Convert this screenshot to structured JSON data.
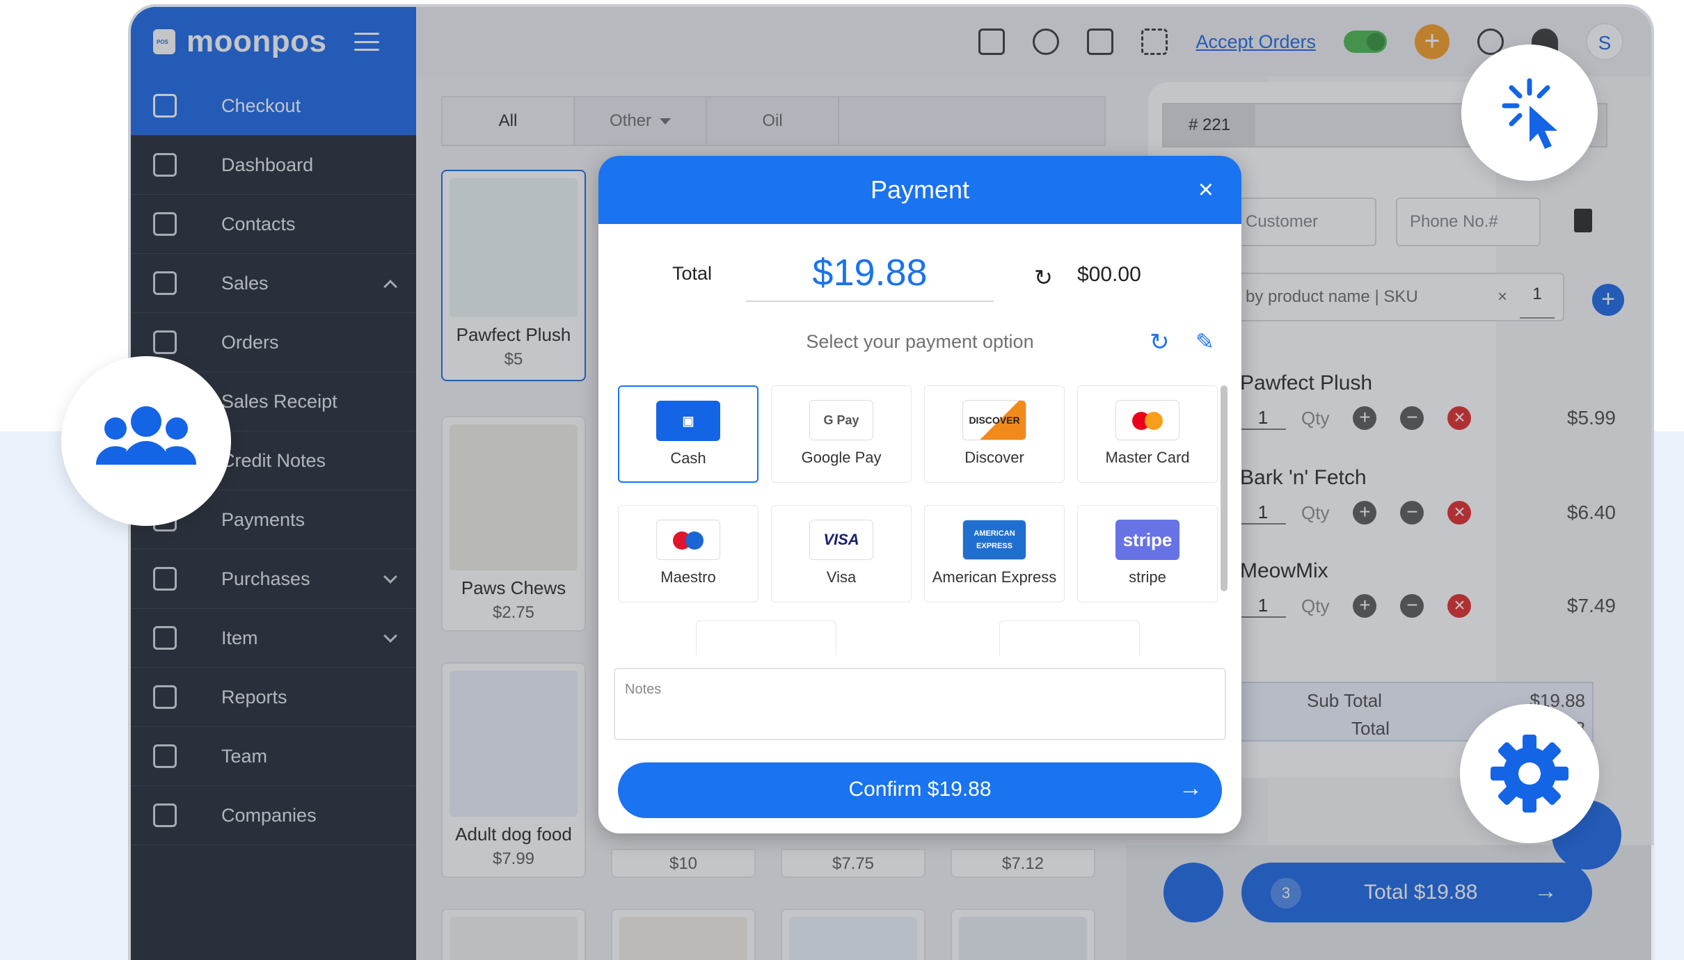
{
  "brand": {
    "name": "moonpos"
  },
  "sidebar": {
    "items": [
      {
        "label": "Checkout",
        "active": true
      },
      {
        "label": "Dashboard"
      },
      {
        "label": "Contacts"
      },
      {
        "label": "Sales",
        "expanded": true
      },
      {
        "label": "Orders"
      },
      {
        "label": "Sales Receipt"
      },
      {
        "label": "Credit Notes"
      },
      {
        "label": "Payments"
      },
      {
        "label": "Purchases"
      },
      {
        "label": "Item"
      },
      {
        "label": "Reports"
      },
      {
        "label": "Team"
      },
      {
        "label": "Companies"
      }
    ]
  },
  "topbar": {
    "accept_orders": "Accept Orders",
    "plus": "+",
    "avatar": "S"
  },
  "tabs": {
    "all": "All",
    "other": "Other",
    "oil": "Oil"
  },
  "products": [
    {
      "name": "Pawfect Plush",
      "price": "$5"
    },
    {
      "name": "Paws Chews",
      "price": "$2.75"
    },
    {
      "name": "Adult dog food",
      "price": "$7.99"
    },
    {
      "name": "",
      "price": "$10"
    },
    {
      "name": "",
      "price": "$7.75"
    },
    {
      "name": "",
      "price": "$7.12"
    }
  ],
  "cart": {
    "order_no": "# 221",
    "customer_placeholder": "Customer",
    "phone_placeholder": "Phone No.#",
    "search_placeholder": "by product name | SKU",
    "search_qty": "1",
    "clear": "×",
    "qty_label": "Qty",
    "items": [
      {
        "name": "Pawfect Plush",
        "qty": "1",
        "price": "$5.99"
      },
      {
        "name": "Bark 'n' Fetch",
        "qty": "1",
        "price": "$6.40"
      },
      {
        "name": "MeowMix",
        "qty": "1",
        "price": "$7.49"
      }
    ],
    "sub_total_label": "Sub Total",
    "sub_total_value": "$19.88",
    "total_label": "Total",
    "total_value_partial": "88",
    "count": "3",
    "total_button": "Total $19.88"
  },
  "payment": {
    "title": "Payment",
    "close": "×",
    "total_label": "Total",
    "amount": "$19.88",
    "change": "$00.00",
    "select_prompt": "Select your payment option",
    "methods": [
      {
        "label": "Cash",
        "logo": "cash-icon",
        "selected": true
      },
      {
        "label": "Google Pay",
        "logo": "G Pay"
      },
      {
        "label": "Discover",
        "logo": "DISCOVER"
      },
      {
        "label": "Master Card",
        "logo": "mastercard"
      },
      {
        "label": "Maestro",
        "logo": "maestro"
      },
      {
        "label": "Visa",
        "logo": "VISA"
      },
      {
        "label": "American Express",
        "logo": "AMERICAN EXPRESS"
      },
      {
        "label": "stripe",
        "logo": "stripe"
      }
    ],
    "notes_placeholder": "Notes",
    "confirm": "Confirm $19.88",
    "arrow": "→"
  },
  "colors": {
    "primary": "#1a73f0",
    "sidebar": "#1c2430",
    "accent": "#f39a1e",
    "toggle": "#43b649",
    "danger": "#e02424"
  }
}
